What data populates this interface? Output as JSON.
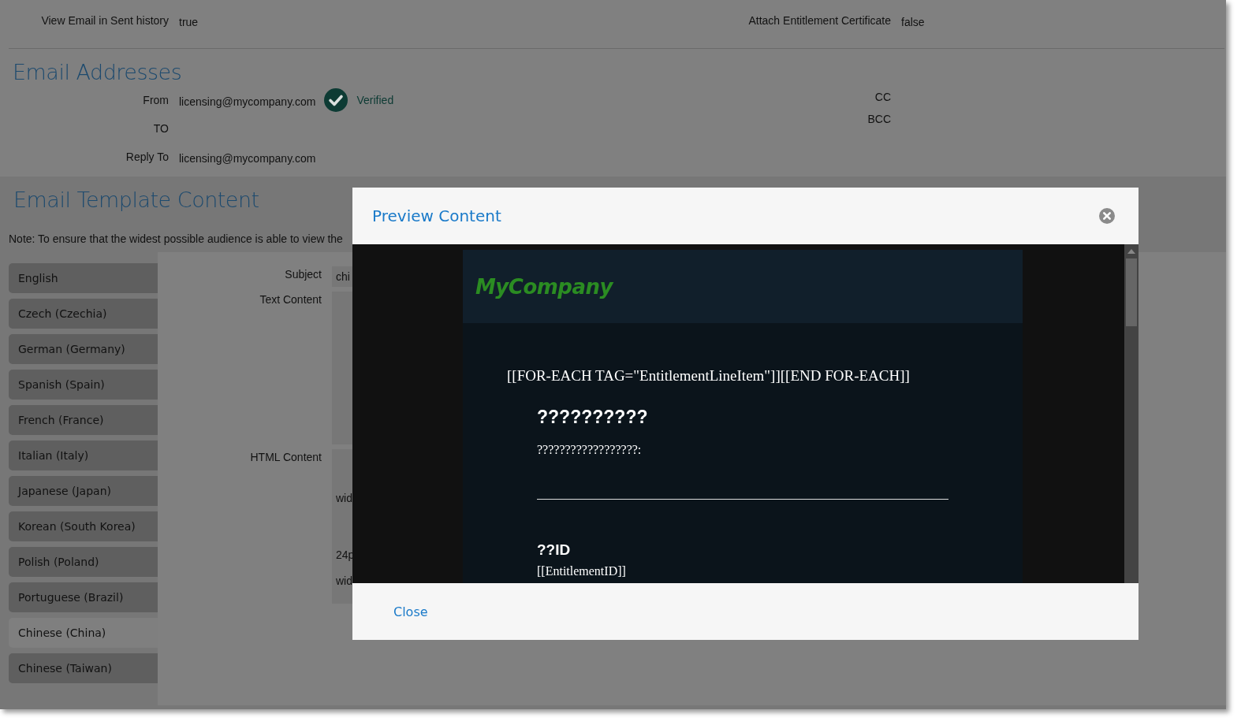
{
  "settings": [
    {
      "label": "View Email in Sent history",
      "value": "true"
    },
    {
      "label": "Attach Entitlement Certificate",
      "value": "false"
    }
  ],
  "email_addresses": {
    "title": "Email Addresses",
    "left": [
      {
        "label": "From",
        "value": "licensing@mycompany.com",
        "verified": true,
        "verified_label": "Verified"
      },
      {
        "label": "TO"
      },
      {
        "label": "Reply To",
        "value": "licensing@mycompany.com"
      }
    ],
    "right": [
      {
        "label": "CC"
      },
      {
        "label": "BCC"
      }
    ]
  },
  "template": {
    "title": "Email Template Content",
    "note": "Note: To ensure that the widest possible audience is able to view the",
    "languages": [
      {
        "label": "English",
        "selected": false
      },
      {
        "label": "Czech (Czechia)",
        "selected": false
      },
      {
        "label": "German (Germany)",
        "selected": false
      },
      {
        "label": "Spanish (Spain)",
        "selected": false
      },
      {
        "label": "French (France)",
        "selected": false
      },
      {
        "label": "Italian (Italy)",
        "selected": false
      },
      {
        "label": "Japanese (Japan)",
        "selected": false
      },
      {
        "label": "Korean (South Korea)",
        "selected": false
      },
      {
        "label": "Polish (Poland)",
        "selected": false
      },
      {
        "label": "Portuguese (Brazil)",
        "selected": false
      },
      {
        "label": "Chinese (China)",
        "selected": true
      },
      {
        "label": "Chinese (Taiwan)",
        "selected": false
      }
    ],
    "fields": [
      {
        "kind": "line",
        "label": "Subject",
        "value": "chi"
      },
      {
        "kind": "text",
        "label": "Text Content"
      },
      {
        "kind": "html",
        "label": "HTML Content",
        "lines": [
          "wid",
          "24p",
          "wid"
        ]
      }
    ]
  },
  "modal": {
    "title": "Preview Content",
    "close_button": "Close",
    "email": {
      "logo": "MyCompany",
      "loop_tag": "[[FOR-EACH TAG=\"EntitlementLineItem\"]][[END FOR-EACH]]",
      "heading": "??????????",
      "intro": "??????????????????:",
      "sections": [
        {
          "heading": "??ID",
          "value": "[[EntitlementID]]"
        }
      ]
    }
  }
}
